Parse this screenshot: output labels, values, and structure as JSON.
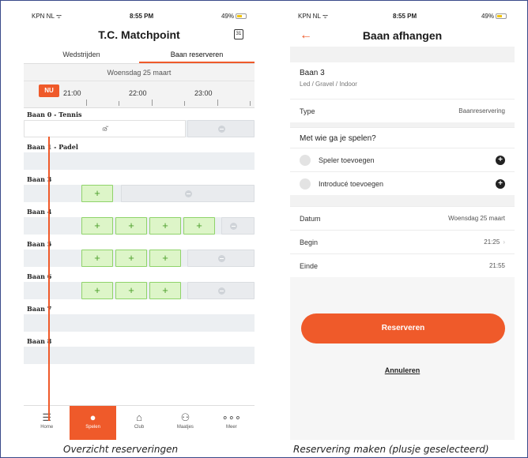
{
  "left": {
    "status": {
      "carrier": "KPN NL",
      "time": "8:55 PM",
      "battery": "49%"
    },
    "title": "T.C. Matchpoint",
    "calendar_day": "31",
    "tabs": [
      "Wedstrijden",
      "Baan reserveren"
    ],
    "date": "Woensdag 25 maart",
    "times": [
      "21:00",
      "22:00",
      "23:00"
    ],
    "now_label": "NU",
    "courts": [
      "Baan 0 - Tennis",
      "Baan 1 - Padel",
      "Baan 3",
      "Baan 4",
      "Baan 5",
      "Baan 6",
      "Baan 7",
      "Baan 8"
    ],
    "nav": [
      "Home",
      "Spelen",
      "Club",
      "Maatjes",
      "Meer"
    ],
    "caption": "Overzicht reserveringen"
  },
  "right": {
    "status": {
      "carrier": "KPN NL",
      "time": "8:55 PM",
      "battery": "49%"
    },
    "title": "Baan afhangen",
    "court": "Baan 3",
    "court_sub": "Led / Gravel / Indoor",
    "type_label": "Type",
    "type_value": "Baanreservering",
    "players_heading": "Met wie ga je spelen?",
    "add_player": "Speler toevoegen",
    "add_intro": "Introducé toevoegen",
    "date_label": "Datum",
    "date_value": "Woensdag 25 maart",
    "begin_label": "Begin",
    "begin_value": "21:25",
    "end_label": "Einde",
    "end_value": "21:55",
    "reserve_button": "Reserveren",
    "cancel_link": "Annuleren",
    "caption": "Reservering maken (plusje geselecteerd)"
  },
  "colors": {
    "accent": "#ef5a2a",
    "available_fill": "#ddf5c8",
    "available_border": "#8fd36a"
  }
}
